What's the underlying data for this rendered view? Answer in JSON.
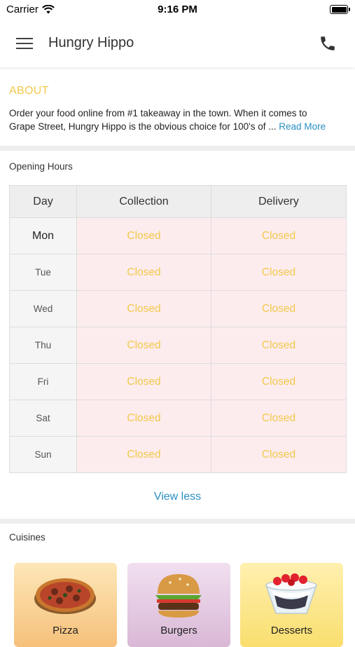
{
  "status_bar": {
    "carrier": "Carrier",
    "time": "9:16 PM"
  },
  "header": {
    "title": "Hungry Hippo"
  },
  "about": {
    "heading": "ABOUT",
    "line1": "Order your food online from #1 takeaway in the town. When it comes to",
    "line2": "Grape Street, Hungry Hippo is the obvious choice for 100's of ...",
    "read_more": "Read More"
  },
  "opening_hours": {
    "label": "Opening Hours",
    "columns": [
      "Day",
      "Collection",
      "Delivery"
    ],
    "rows": [
      {
        "day": "Mon",
        "collection": "Closed",
        "delivery": "Closed"
      },
      {
        "day": "Tue",
        "collection": "Closed",
        "delivery": "Closed"
      },
      {
        "day": "Wed",
        "collection": "Closed",
        "delivery": "Closed"
      },
      {
        "day": "Thu",
        "collection": "Closed",
        "delivery": "Closed"
      },
      {
        "day": "Fri",
        "collection": "Closed",
        "delivery": "Closed"
      },
      {
        "day": "Sat",
        "collection": "Closed",
        "delivery": "Closed"
      },
      {
        "day": "Sun",
        "collection": "Closed",
        "delivery": "Closed"
      }
    ],
    "toggle_label": "View less"
  },
  "cuisines": {
    "label": "Cuisines",
    "items": [
      {
        "label": "Pizza",
        "icon": "pizza-icon"
      },
      {
        "label": "Burgers",
        "icon": "burger-icon"
      },
      {
        "label": "Desserts",
        "icon": "dessert-icon"
      }
    ]
  },
  "colors": {
    "accent_yellow": "#f2c94c",
    "link_blue": "#2a8fc4",
    "closed_bg": "#fdecee"
  }
}
